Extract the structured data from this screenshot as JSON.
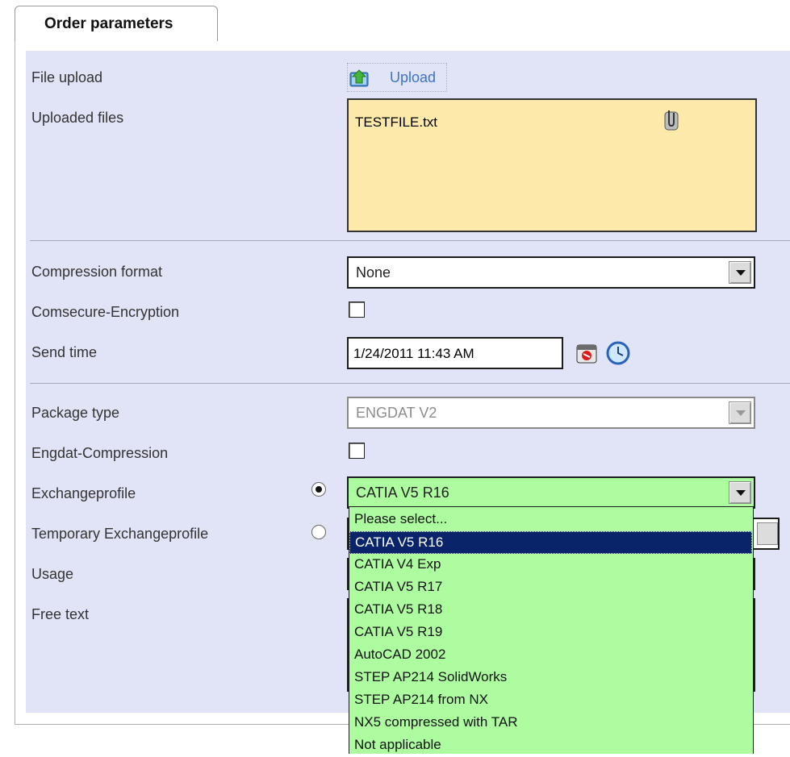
{
  "tab": {
    "label": "Order parameters"
  },
  "form": {
    "file_upload_label": "File upload",
    "upload_button": "Upload",
    "uploaded_files_label": "Uploaded files",
    "uploaded_files": [
      "TESTFILE.txt"
    ],
    "compression_format_label": "Compression format",
    "compression_format_value": "None",
    "comsecure_label": "Comsecure-Encryption",
    "comsecure_checked": false,
    "send_time_label": "Send time",
    "send_time_value": "1/24/2011 11:43 AM",
    "package_type_label": "Package type",
    "package_type_value": "ENGDAT V2",
    "engdat_compression_label": "Engdat-Compression",
    "engdat_compression_checked": false,
    "exchangeprofile_label": "Exchangeprofile",
    "exchangeprofile_value": "CATIA V5 R16",
    "exchangeprofile_radio_selected": true,
    "temporary_exchangeprofile_label": "Temporary Exchangeprofile",
    "temporary_radio_selected": false,
    "usage_label": "Usage",
    "free_text_label": "Free text"
  },
  "dropdown": {
    "options": [
      "Please select...",
      "CATIA V5 R16",
      "CATIA V4 Exp",
      "CATIA V5 R17",
      "CATIA V5 R18",
      "CATIA V5 R19",
      "AutoCAD 2002",
      "STEP AP214 SolidWorks",
      "STEP AP214 from NX",
      "NX5 compressed with TAR",
      "Not applicable"
    ],
    "selected": "CATIA V5 R16"
  },
  "icons": {
    "upload": "upload-icon",
    "attachment": "paperclip-icon",
    "calendar": "calendar-icon",
    "clock": "clock-icon"
  },
  "colors": {
    "panel": "#e1e3f7",
    "files_box": "#fde9a9",
    "profile_green": "#aefca0",
    "highlight": "#0a246a",
    "link": "#3d74c4"
  }
}
